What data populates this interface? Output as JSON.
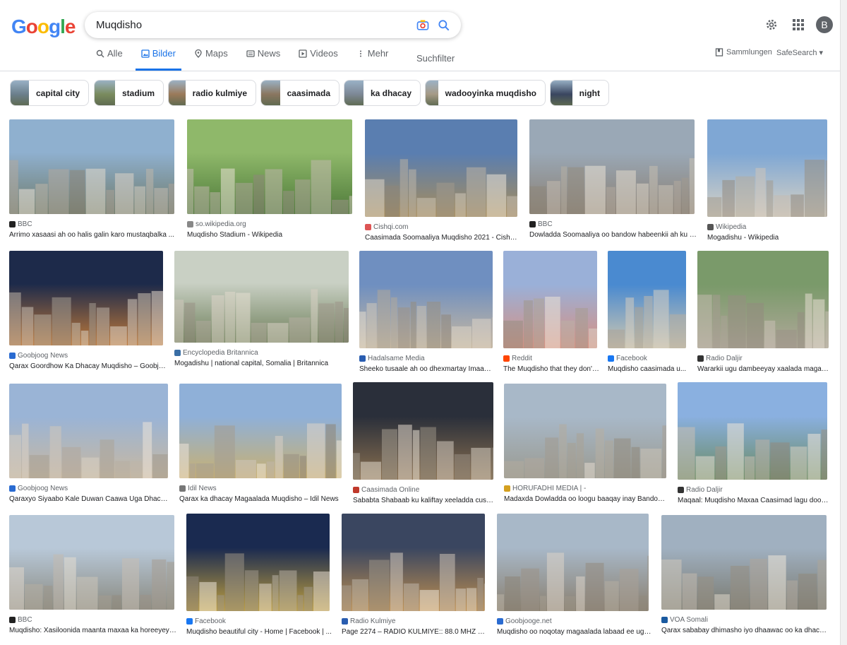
{
  "search": {
    "query": "Muqdisho"
  },
  "user": {
    "avatar_letter": "B"
  },
  "tabs": [
    {
      "label": "Alle"
    },
    {
      "label": "Bilder"
    },
    {
      "label": "Maps"
    },
    {
      "label": "News"
    },
    {
      "label": "Videos"
    },
    {
      "label": "Mehr"
    }
  ],
  "tools": {
    "suchfilter": "Suchfilter",
    "sammlungen": "Sammlungen",
    "safesearch": "SafeSearch"
  },
  "chips": [
    {
      "label": "capital city",
      "color": "#6b7f8c"
    },
    {
      "label": "stadium",
      "color": "#7a8b5e"
    },
    {
      "label": "radio kulmiye",
      "color": "#9b7a5a"
    },
    {
      "label": "caasimada",
      "color": "#8a7660"
    },
    {
      "label": "ka dhacay",
      "color": "#7d8896"
    },
    {
      "label": "wadooyinka muqdisho",
      "color": "#a69a86"
    },
    {
      "label": "night",
      "color": "#3a4660"
    }
  ],
  "results": [
    {
      "source": "BBC",
      "title": "Arrimo xasaasi ah oo halis galin karo mustaqbalka ...",
      "fav": "#222",
      "c1": "#8fb0cf",
      "c2": "#6f7b6a"
    },
    {
      "source": "so.wikipedia.org",
      "title": "Muqdisho Stadium - Wikipedia",
      "fav": "#888",
      "c1": "#8fb86a",
      "c2": "#4e7a3a"
    },
    {
      "source": "Cishqi.com",
      "title": "Caasimada Soomaaliya Muqdisho 2021 - Cishqi.com",
      "fav": "#d55",
      "c1": "#5a7eb0",
      "c2": "#a88d5a"
    },
    {
      "source": "BBC",
      "title": "Dowladda Soomaaliya oo bandow habeenkii ah ku soo rog...",
      "fav": "#222",
      "c1": "#9aa8b6",
      "c2": "#8a7f72"
    },
    {
      "source": "Wikipedia",
      "title": "Mogadishu - Wikipedia",
      "fav": "#555",
      "c1": "#7fa7d4",
      "c2": "#d8d2c4"
    },
    {
      "source": "Goobjoog News",
      "title": "Qarax Goordhow Ka Dhacay Muqdisho – Goobjoog News",
      "fav": "#2a6bd1",
      "c1": "#1d2a4a",
      "c2": "#c07a3a"
    },
    {
      "source": "Encyclopedia Britannica",
      "title": "Mogadishu | national capital, Somalia | Britannica",
      "fav": "#3a6ea5",
      "c1": "#c9d0c4",
      "c2": "#6e7f5a"
    },
    {
      "source": "Hadalsame Media",
      "title": "Sheeko tusaale ah oo dhexmartay Imaamka ...",
      "fav": "#2a5db0",
      "c1": "#6f8fc0",
      "c2": "#c9b9a0"
    },
    {
      "source": "Reddit",
      "title": "The Muqdisho that they don't ...",
      "fav": "#ff4500",
      "c1": "#9ab0d8",
      "c2": "#d89080"
    },
    {
      "source": "Facebook",
      "title": "Muqdisho caasimada u...",
      "fav": "#1877f2",
      "c1": "#4a8ad0",
      "c2": "#d0c8b0"
    },
    {
      "source": "Radio Daljir",
      "title": "Wararkii ugu dambeeyay xaalada magaal...",
      "fav": "#333",
      "c1": "#7a9a6a",
      "c2": "#b0a89a"
    },
    {
      "source": "Goobjoog News",
      "title": "Qaraxyo Siyaabo Kale Duwan Caawa Uga Dhacay ...",
      "fav": "#2a6bd1",
      "c1": "#9ab4d6",
      "c2": "#c8b8a0"
    },
    {
      "source": "Idil News",
      "title": "Qarax ka dhacay Magaalada Muqdisho – Idil News",
      "fav": "#777",
      "c1": "#8fb0d8",
      "c2": "#c9b070"
    },
    {
      "source": "Caasimada Online",
      "title": "Sababta Shabaab ku kaliftay xeeladda cusub ...",
      "fav": "#c0392b",
      "c1": "#2a2f3a",
      "c2": "#8a7050"
    },
    {
      "source": "HORUFADHI MEDIA | -",
      "title": "Madaxda Dowladda oo loogu baaqay inay Bandow ...",
      "fav": "#d4a020",
      "c1": "#a8b8c8",
      "c2": "#9a9a90"
    },
    {
      "source": "Radio Daljir",
      "title": "Maqaal: Muqdisho Maxaa Caasimad lagu doortay ...",
      "fav": "#333",
      "c1": "#8ab0e0",
      "c2": "#6a8a60"
    },
    {
      "source": "BBC",
      "title": "Muqdisho: Xasiloonida maanta maxaa ka horeeyey e...",
      "fav": "#222",
      "c1": "#b8c8d8",
      "c2": "#8a8a80"
    },
    {
      "source": "Facebook",
      "title": "Muqdisho beautiful city - Home | Facebook | ...",
      "fav": "#1877f2",
      "c1": "#1a2a50",
      "c2": "#c0a040"
    },
    {
      "source": "Radio Kulmiye",
      "title": "Page 2274 – RADIO KULMIYE:: 88.0 MHZ Mo...",
      "fav": "#2a5db0",
      "c1": "#3a4660",
      "c2": "#c09050"
    },
    {
      "source": "Goobjooge.net",
      "title": "Muqdisho oo noqotay magaalada labaad ee ugu...",
      "fav": "#2a6bd1",
      "c1": "#a8b8c8",
      "c2": "#8a8070"
    },
    {
      "source": "VOA Somali",
      "title": "Qarax sababay dhimasho iyo dhaawac oo ka dhacay ...",
      "fav": "#1a5aa0",
      "c1": "#a0b0c0",
      "c2": "#7a7a70"
    }
  ]
}
